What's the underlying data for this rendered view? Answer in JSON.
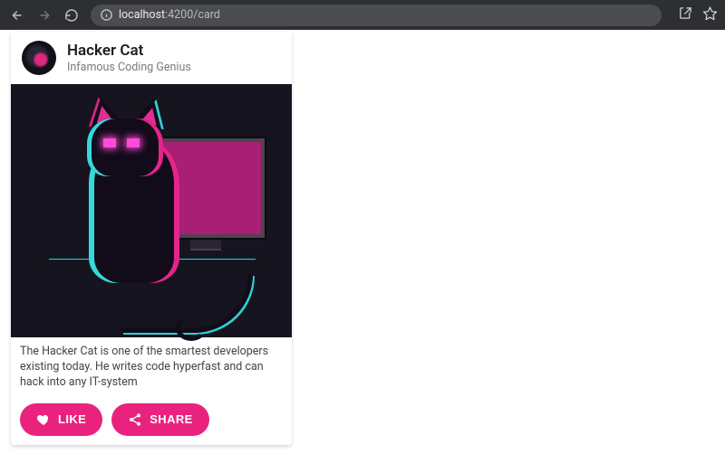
{
  "browser": {
    "url_display_prefix": "localhost",
    "url_display_suffix": ":4200/card"
  },
  "card": {
    "title": "Hacker Cat",
    "subtitle": "Infamous Coding Genius",
    "description": "The Hacker Cat is one of the smartest developers existing today. He writes code hyperfast and can hack into any IT-system",
    "like_label": "LIKE",
    "share_label": "SHARE"
  },
  "colors": {
    "accent": "#e9227e"
  }
}
